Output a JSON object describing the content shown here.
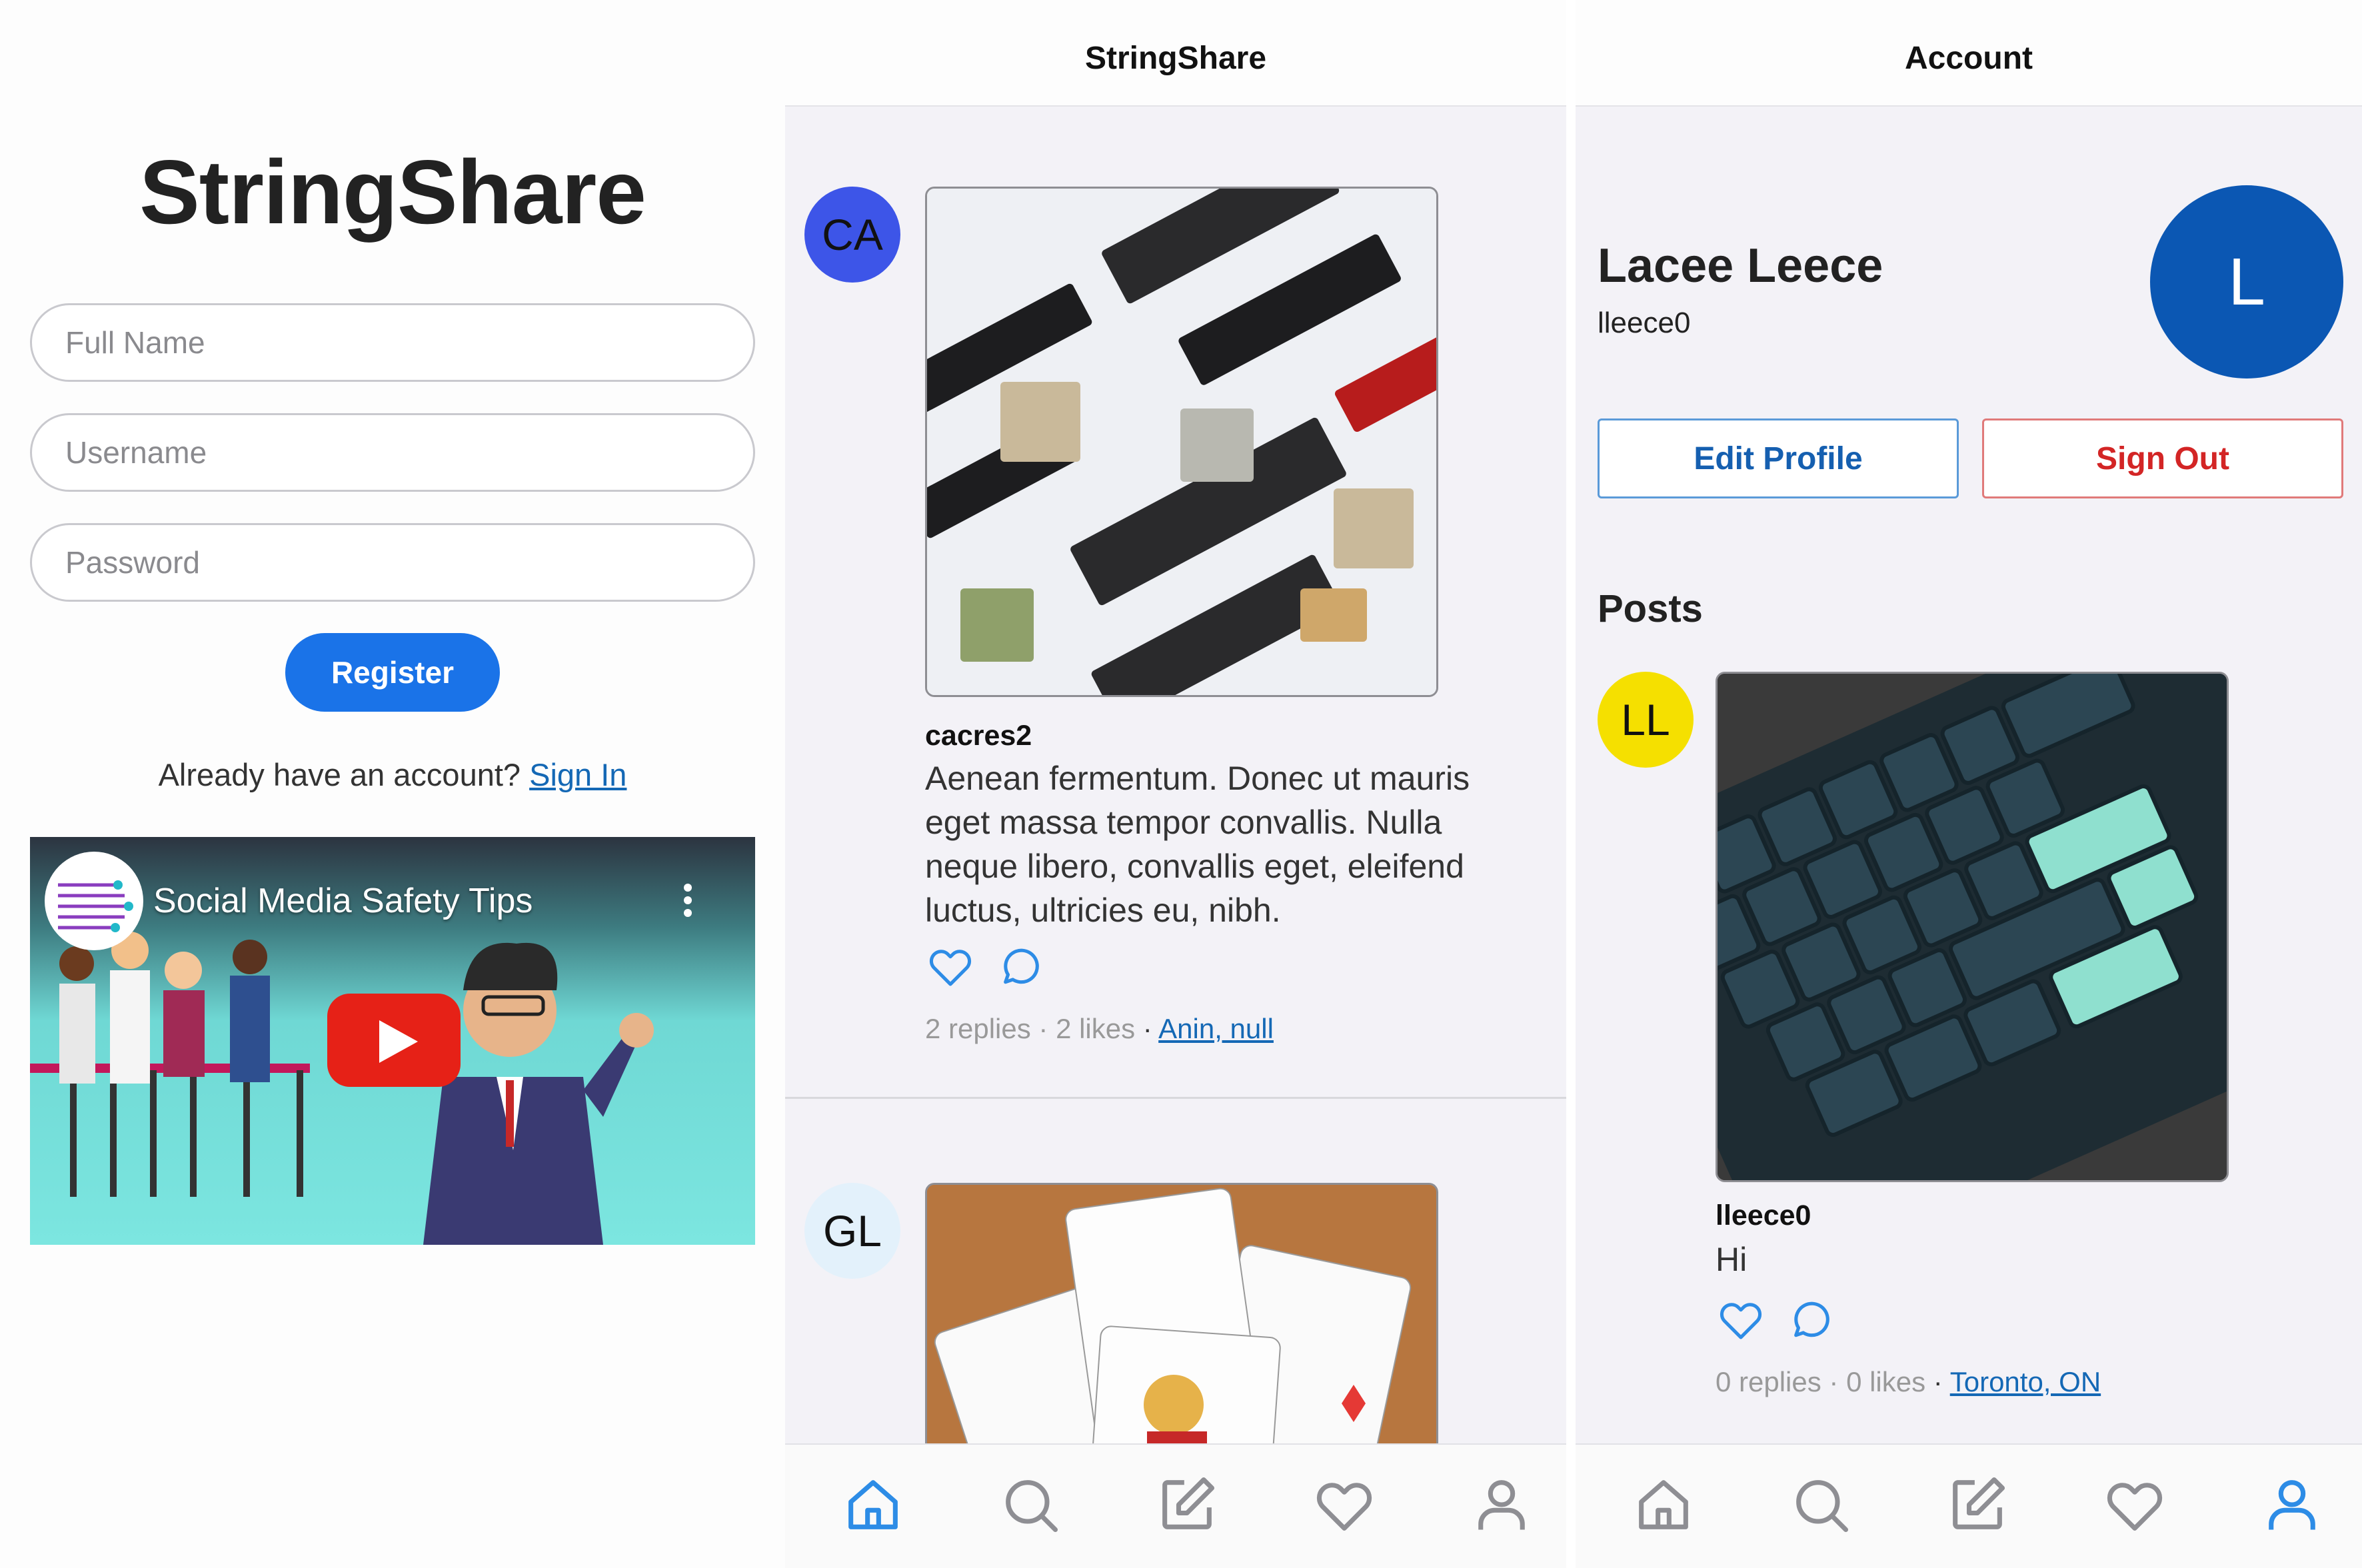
{
  "register": {
    "title": "StringShare",
    "full_name_placeholder": "Full Name",
    "username_placeholder": "Username",
    "password_placeholder": "Password",
    "register_label": "Register",
    "have_account_text": "Already have an account?",
    "sign_in_link": "Sign In",
    "video": {
      "title": "Social Media Safety Tips"
    }
  },
  "feed": {
    "nav_title": "StringShare",
    "posts": [
      {
        "avatar_initials": "CA",
        "avatar_color": "#3d55e8",
        "username": "cacres2",
        "text": "Aenean fermentum. Donec ut mauris eget massa tempor convallis. Nulla neque libero, convallis eget, eleifend luctus, ultricies eu, nibh.",
        "meta": "2 replies · 2 likes",
        "separator": "·",
        "link": "Anin, null",
        "image_desc": "memory-and-cpu-photo"
      },
      {
        "avatar_initials": "GL",
        "avatar_color": "#e3f1fb",
        "image_desc": "playing-cards-photo"
      }
    ]
  },
  "account": {
    "nav_title": "Account",
    "name": "Lacee Leece",
    "username": "lleece0",
    "avatar_initial": "L",
    "avatar_color": "#0b57b3",
    "edit_profile_label": "Edit Profile",
    "sign_out_label": "Sign Out",
    "posts_heading": "Posts",
    "post": {
      "avatar_initials": "LL",
      "avatar_color": "#f5e000",
      "username": "lleece0",
      "text": "Hi",
      "meta": "0 replies · 0 likes",
      "separator": "·",
      "link": "Toronto, ON",
      "image_desc": "keyboard-photo"
    }
  },
  "tabs": [
    "home",
    "search",
    "compose",
    "likes",
    "profile"
  ],
  "colors": {
    "accent": "#1a73e8",
    "link": "#1468b5",
    "icon_blue": "#2d8ce6",
    "tab_inactive": "#8e8e93"
  }
}
